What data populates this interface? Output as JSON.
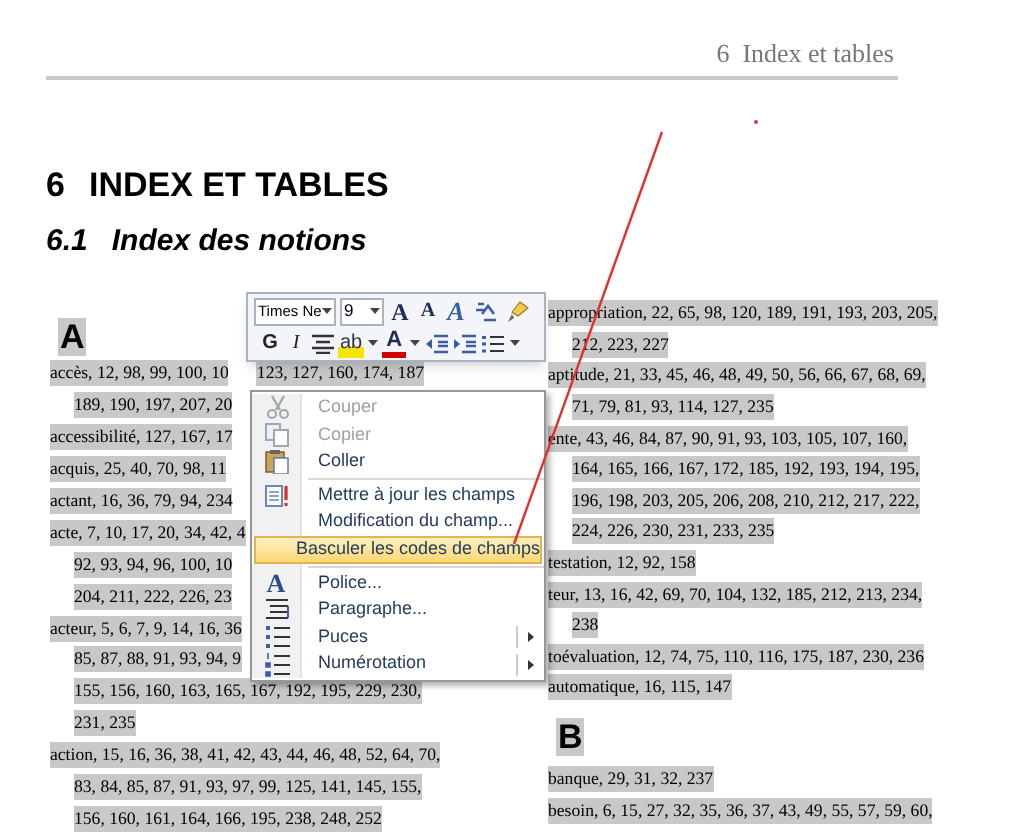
{
  "header": {
    "text": "6  Index et tables"
  },
  "heading": {
    "number": "6",
    "title": "INDEX ET TABLES"
  },
  "subheading": {
    "number": "6.1",
    "title": "Index des notions"
  },
  "left_column": {
    "letter": "A",
    "lines": [
      {
        "kind": "entry",
        "text": "accès, 12, 98, 99, 100, 10",
        "text_after": "123, 127, 160, 174, 187"
      },
      {
        "kind": "continuation",
        "text": "189, 190, 197, 207, 20"
      },
      {
        "kind": "entry",
        "text": "accessibilité, 127, 167, 17"
      },
      {
        "kind": "entry",
        "text": "acquis, 25, 40, 70, 98, 11"
      },
      {
        "kind": "entry",
        "text": "actant, 16, 36, 79, 94, 234"
      },
      {
        "kind": "entry",
        "text": "acte, 7, 10, 17, 20, 34, 42, 4"
      },
      {
        "kind": "continuation",
        "text": "92, 93, 94, 96, 100, 10"
      },
      {
        "kind": "continuation",
        "text": "204, 211, 222, 226, 23"
      },
      {
        "kind": "entry",
        "text": "acteur, 5, 6, 7, 9, 14, 16, 36"
      },
      {
        "kind": "continuation",
        "text": "85, 87, 88, 91, 93, 94, 9"
      },
      {
        "kind": "continuation",
        "text": "155, 156, 160, 163, 165, 167, 192, 195, 229, 230,"
      },
      {
        "kind": "continuation",
        "text": "231, 235"
      },
      {
        "kind": "entry",
        "text": "action, 15, 16, 36, 38, 41, 42, 43, 44, 46, 48, 52, 64, 70,"
      },
      {
        "kind": "continuation",
        "text": "83, 84, 85, 87, 91, 93, 97, 99, 125, 141, 145, 155,"
      },
      {
        "kind": "continuation",
        "text": "156, 160, 161, 164, 166, 195, 238, 248, 252"
      }
    ]
  },
  "right_column": {
    "lines": [
      {
        "kind": "entry",
        "text": "appropriation, 22, 65, 98, 120, 189, 191, 193, 203, 205,"
      },
      {
        "kind": "continuation",
        "text": "212, 223, 227"
      },
      {
        "kind": "entry",
        "text": "aptitude, 21, 33, 45, 46, 48, 49, 50, 56, 66, 67, 68, 69,"
      },
      {
        "kind": "continuation",
        "text": "71, 79, 81, 93, 114, 127, 235"
      },
      {
        "kind": "entry",
        "text": "ente, 43, 46, 84, 87, 90, 91, 93, 103, 105, 107, 160,"
      },
      {
        "kind": "continuation",
        "text": "164, 165, 166, 167, 172, 185, 192, 193, 194, 195,"
      },
      {
        "kind": "continuation",
        "text": "196, 198, 203, 205, 206, 208, 210, 212, 217, 222,"
      },
      {
        "kind": "continuation",
        "text": "224, 226, 230, 231, 233, 235"
      },
      {
        "kind": "entry",
        "text": "testation, 12, 92, 158"
      },
      {
        "kind": "entry",
        "text": "teur, 13, 16, 42, 69, 70, 104, 132, 185, 212, 213, 234,"
      },
      {
        "kind": "continuation",
        "text": "238"
      },
      {
        "kind": "entry",
        "text": "toévaluation, 12, 74, 75, 110, 116, 175, 187, 230, 236"
      },
      {
        "kind": "entry",
        "text": "automatique, 16, 115, 147"
      },
      {
        "kind": "letter",
        "text": "B"
      },
      {
        "kind": "entry",
        "text": "banque, 29, 31, 32, 237"
      },
      {
        "kind": "entry",
        "text": "besoin, 6, 15, 27, 32, 35, 36, 37, 43, 49, 55, 57, 59, 60,"
      }
    ]
  },
  "mini_toolbar": {
    "font": "Times Ne",
    "size": "9",
    "top_row": {
      "buttons": [
        {
          "kind": "grow",
          "label": "A"
        },
        {
          "kind": "shrink",
          "label": "A"
        },
        {
          "kind": "styles",
          "label": "A"
        },
        {
          "kind": "change-case"
        },
        {
          "kind": "painter"
        }
      ]
    },
    "bottom_row": {
      "buttons": [
        {
          "kind": "bold",
          "label": "G"
        },
        {
          "kind": "italic",
          "label": "I"
        },
        {
          "kind": "align"
        },
        {
          "kind": "highlight",
          "label": "ab"
        },
        {
          "kind": "dropdown"
        },
        {
          "kind": "font-color",
          "label": "A"
        },
        {
          "kind": "dropdown"
        },
        {
          "kind": "outdent"
        },
        {
          "kind": "indent"
        },
        {
          "kind": "bullets"
        },
        {
          "kind": "dropdown"
        }
      ]
    }
  },
  "context_menu": {
    "items": [
      {
        "kind": "cut",
        "label": "Couper",
        "disabled": true,
        "selected": false,
        "submenu": false
      },
      {
        "kind": "copy",
        "label": "Copier",
        "disabled": true,
        "selected": false,
        "submenu": false
      },
      {
        "kind": "paste",
        "label": "Coller",
        "disabled": false,
        "selected": false,
        "submenu": false
      },
      {
        "kind": "separator"
      },
      {
        "kind": "update",
        "label": "Mettre à jour les champs",
        "disabled": false,
        "selected": false,
        "submenu": false
      },
      {
        "kind": "plain",
        "label": "Modification du champ...",
        "disabled": false,
        "selected": false,
        "submenu": false
      },
      {
        "kind": "plain",
        "label": "Basculer les codes de champs",
        "disabled": false,
        "selected": true,
        "submenu": false
      },
      {
        "kind": "separator"
      },
      {
        "kind": "font",
        "label": "Police...",
        "icon_text": "A",
        "disabled": false,
        "selected": false,
        "submenu": false
      },
      {
        "kind": "paragraph",
        "label": "Paragraphe...",
        "disabled": false,
        "selected": false,
        "submenu": false
      },
      {
        "kind": "bullets",
        "label": "Puces",
        "disabled": false,
        "selected": false,
        "submenu": true
      },
      {
        "kind": "numbering",
        "label": "Numérotation",
        "disabled": false,
        "selected": false,
        "submenu": true
      }
    ]
  }
}
